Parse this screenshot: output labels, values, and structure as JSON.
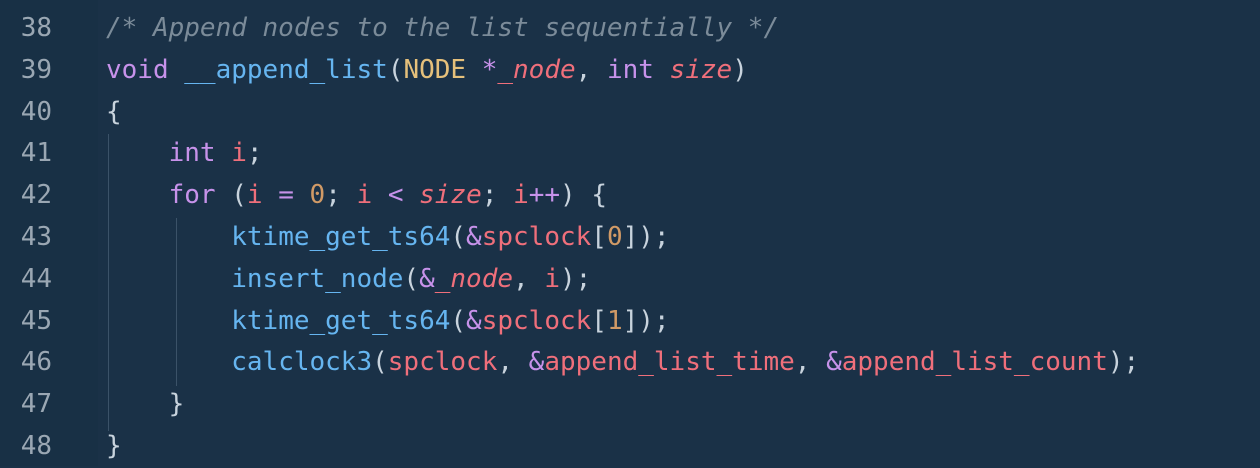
{
  "editor": {
    "lines": [
      {
        "number": "38",
        "tokens": [
          {
            "t": "/* Append nodes to the list sequentially */",
            "k": "comment"
          }
        ]
      },
      {
        "number": "39",
        "tokens": [
          {
            "t": "void",
            "k": "keyword"
          },
          {
            "t": " ",
            "k": "punct"
          },
          {
            "t": "__append_list",
            "k": "func"
          },
          {
            "t": "(",
            "k": "punct"
          },
          {
            "t": "NODE",
            "k": "type"
          },
          {
            "t": " ",
            "k": "punct"
          },
          {
            "t": "*",
            "k": "op"
          },
          {
            "t": "_node",
            "k": "param"
          },
          {
            "t": ", ",
            "k": "punct"
          },
          {
            "t": "int",
            "k": "keyword"
          },
          {
            "t": " ",
            "k": "punct"
          },
          {
            "t": "size",
            "k": "param"
          },
          {
            "t": ")",
            "k": "punct"
          }
        ]
      },
      {
        "number": "40",
        "tokens": [
          {
            "t": "{",
            "k": "punct"
          }
        ]
      },
      {
        "number": "41",
        "tokens": [
          {
            "t": "    ",
            "k": "punct"
          },
          {
            "t": "int",
            "k": "keyword"
          },
          {
            "t": " ",
            "k": "punct"
          },
          {
            "t": "i",
            "k": "var"
          },
          {
            "t": ";",
            "k": "punct"
          }
        ]
      },
      {
        "number": "42",
        "tokens": [
          {
            "t": "    ",
            "k": "punct"
          },
          {
            "t": "for",
            "k": "keyword"
          },
          {
            "t": " (",
            "k": "punct"
          },
          {
            "t": "i",
            "k": "var"
          },
          {
            "t": " ",
            "k": "punct"
          },
          {
            "t": "=",
            "k": "op"
          },
          {
            "t": " ",
            "k": "punct"
          },
          {
            "t": "0",
            "k": "num"
          },
          {
            "t": "; ",
            "k": "punct"
          },
          {
            "t": "i",
            "k": "var"
          },
          {
            "t": " ",
            "k": "punct"
          },
          {
            "t": "<",
            "k": "op"
          },
          {
            "t": " ",
            "k": "punct"
          },
          {
            "t": "size",
            "k": "param"
          },
          {
            "t": "; ",
            "k": "punct"
          },
          {
            "t": "i",
            "k": "var"
          },
          {
            "t": "++",
            "k": "op"
          },
          {
            "t": ") {",
            "k": "punct"
          }
        ]
      },
      {
        "number": "43",
        "tokens": [
          {
            "t": "        ",
            "k": "punct"
          },
          {
            "t": "ktime_get_ts64",
            "k": "func"
          },
          {
            "t": "(",
            "k": "punct"
          },
          {
            "t": "&",
            "k": "op"
          },
          {
            "t": "spclock",
            "k": "var"
          },
          {
            "t": "[",
            "k": "punct"
          },
          {
            "t": "0",
            "k": "num"
          },
          {
            "t": "]);",
            "k": "punct"
          }
        ]
      },
      {
        "number": "44",
        "tokens": [
          {
            "t": "        ",
            "k": "punct"
          },
          {
            "t": "insert_node",
            "k": "func"
          },
          {
            "t": "(",
            "k": "punct"
          },
          {
            "t": "&",
            "k": "op"
          },
          {
            "t": "_node",
            "k": "param"
          },
          {
            "t": ", ",
            "k": "punct"
          },
          {
            "t": "i",
            "k": "var"
          },
          {
            "t": ");",
            "k": "punct"
          }
        ]
      },
      {
        "number": "45",
        "tokens": [
          {
            "t": "        ",
            "k": "punct"
          },
          {
            "t": "ktime_get_ts64",
            "k": "func"
          },
          {
            "t": "(",
            "k": "punct"
          },
          {
            "t": "&",
            "k": "op"
          },
          {
            "t": "spclock",
            "k": "var"
          },
          {
            "t": "[",
            "k": "punct"
          },
          {
            "t": "1",
            "k": "num"
          },
          {
            "t": "]);",
            "k": "punct"
          }
        ]
      },
      {
        "number": "46",
        "tokens": [
          {
            "t": "        ",
            "k": "punct"
          },
          {
            "t": "calclock3",
            "k": "func"
          },
          {
            "t": "(",
            "k": "punct"
          },
          {
            "t": "spclock",
            "k": "var"
          },
          {
            "t": ", ",
            "k": "punct"
          },
          {
            "t": "&",
            "k": "op"
          },
          {
            "t": "append_list_time",
            "k": "var"
          },
          {
            "t": ", ",
            "k": "punct"
          },
          {
            "t": "&",
            "k": "op"
          },
          {
            "t": "append_list_count",
            "k": "var"
          },
          {
            "t": ");",
            "k": "punct"
          }
        ]
      },
      {
        "number": "47",
        "tokens": [
          {
            "t": "    ",
            "k": "punct"
          },
          {
            "t": "}",
            "k": "punct"
          }
        ]
      },
      {
        "number": "48",
        "tokens": [
          {
            "t": "}",
            "k": "punct"
          }
        ]
      }
    ]
  }
}
